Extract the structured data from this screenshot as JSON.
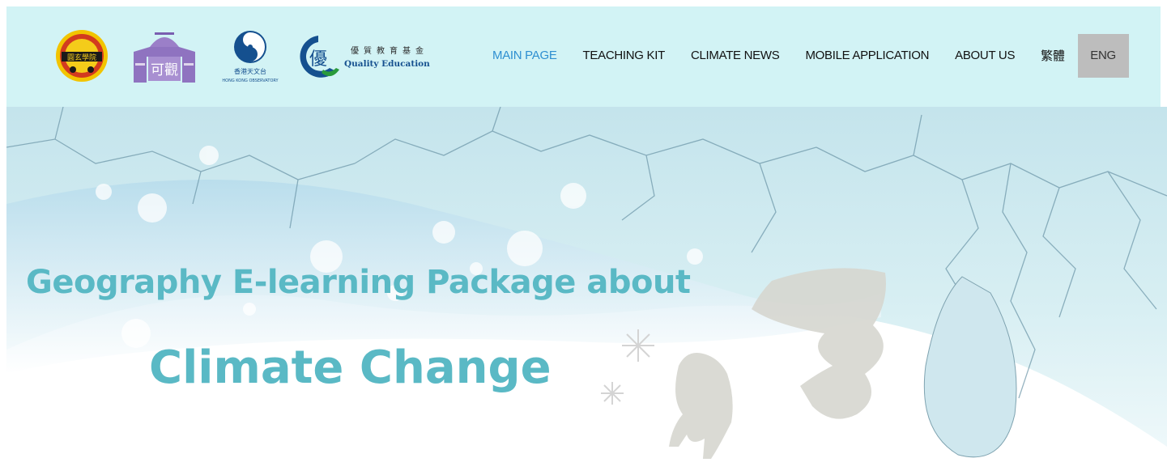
{
  "header": {
    "logos": [
      {
        "name": "school-crest-logo",
        "text": "圓玄學院"
      },
      {
        "name": "ho-koon-logo",
        "text": "可觀"
      },
      {
        "name": "hong-kong-observatory-logo",
        "text_zh": "香港天文台",
        "text_en": "HONG KONG OBSERVATORY"
      },
      {
        "name": "quality-education-fund-logo",
        "text_zh": "優質教育基金",
        "text_en": "Quality Education Fund"
      }
    ]
  },
  "nav": {
    "main_page": "MAIN PAGE",
    "teaching_kit": "TEACHING KIT",
    "climate_news": "CLIMATE NEWS",
    "mobile_application": "MOBILE APPLICATION",
    "about_us": "ABOUT US",
    "lang_tc": "繁體",
    "lang_en": "ENG"
  },
  "hero": {
    "title_line1": "Geography E-learning Package about",
    "title_line2": "Climate Change"
  },
  "colors": {
    "header_bg": "#d2f3f5",
    "active_nav": "#2e8fd1",
    "title": "#5ab9c5",
    "lang_button_bg": "#bdbdbd"
  }
}
